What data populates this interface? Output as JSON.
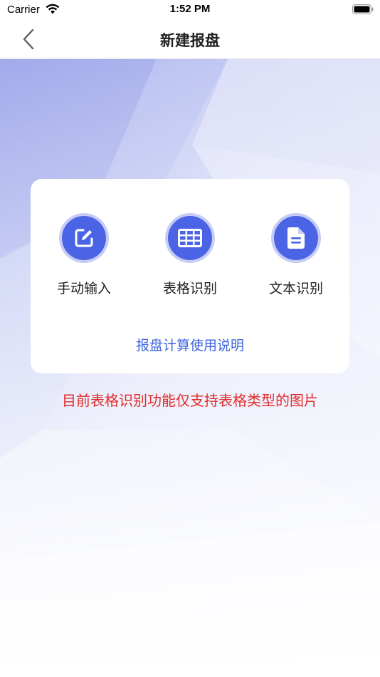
{
  "status_bar": {
    "carrier": "Carrier",
    "time": "1:52 PM"
  },
  "nav": {
    "title": "新建报盘",
    "back_icon": "chevron-left-icon"
  },
  "options": [
    {
      "label": "手动输入",
      "icon": "edit-icon"
    },
    {
      "label": "表格识别",
      "icon": "grid-table-icon"
    },
    {
      "label": "文本识别",
      "icon": "document-icon"
    }
  ],
  "guide_link": "报盘计算使用说明",
  "notice": "目前表格识别功能仅支持表格类型的图片",
  "colors": {
    "accent": "#4b64e6",
    "accent_ring": "#c6ccf4",
    "link": "#3e63dd",
    "warning": "#e12c2c"
  }
}
